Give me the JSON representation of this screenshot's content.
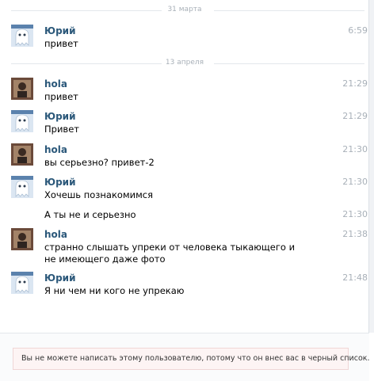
{
  "dates": [
    "31 марта",
    "13 апреля"
  ],
  "messages": [
    {
      "author": "Юрий",
      "avatar": "ghost",
      "time": "6:59",
      "text": "привет"
    },
    {
      "author": "hola",
      "avatar": "person",
      "time": "21:29",
      "text": "привет"
    },
    {
      "author": "Юрий",
      "avatar": "ghost",
      "time": "21:29",
      "text": "Привет"
    },
    {
      "author": "hola",
      "avatar": "person",
      "time": "21:30",
      "text": "вы серьезно? привет-2"
    },
    {
      "author": "Юрий",
      "avatar": "ghost",
      "time": "21:30",
      "text": "Хочешь познакомимся"
    },
    {
      "author": "",
      "avatar": "",
      "time": "21:30",
      "text": "А ты не и серьезно"
    },
    {
      "author": "hola",
      "avatar": "person",
      "time": "21:38",
      "text": "странно слышать упреки от человека тыкающего и не имеющего даже фото"
    },
    {
      "author": "Юрий",
      "avatar": "ghost",
      "time": "21:48",
      "text": "Я ни чем ни кого не упрекаю"
    }
  ],
  "notice": "Вы не можете написать этому пользователю, потому что он внес вас в черный список.",
  "colors": {
    "author": "#2b587a",
    "time": "#a8b0b8",
    "notice_bg": "#fdf4f4",
    "notice_border": "#f0d6d6"
  }
}
